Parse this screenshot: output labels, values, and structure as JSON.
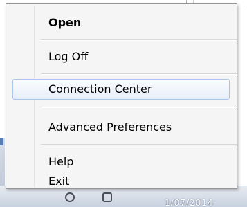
{
  "menu": {
    "items": [
      {
        "label": "Open",
        "bold": true
      },
      {
        "label": "Log Off"
      },
      {
        "label": "Connection Center",
        "highlighted": true
      },
      {
        "label": "Advanced Preferences"
      },
      {
        "label": "Help"
      },
      {
        "label": "Exit"
      }
    ]
  },
  "taskbar": {
    "clock_text": "1/07/2014"
  },
  "colors": {
    "highlight_border": "#a8c5ea",
    "menu_background": "#f5f5f5"
  }
}
